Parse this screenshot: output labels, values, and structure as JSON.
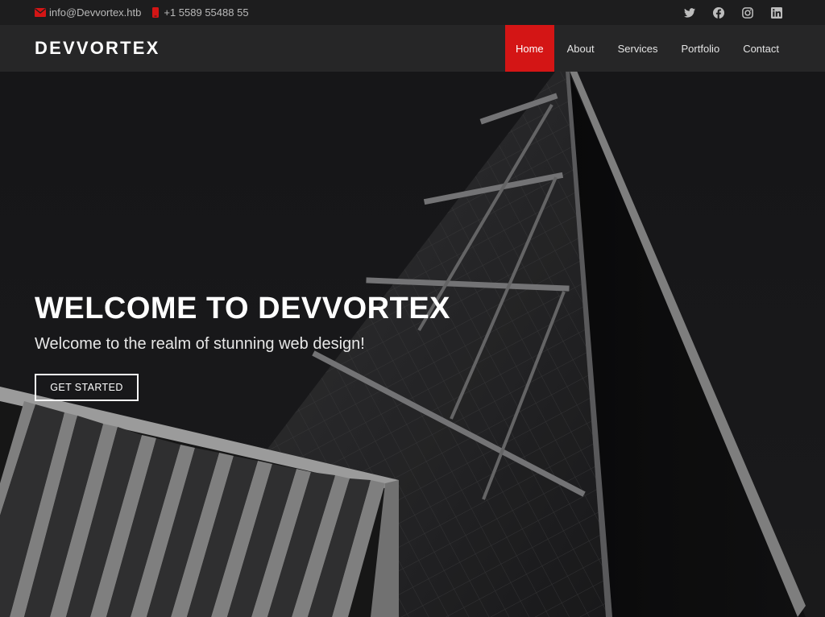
{
  "topbar": {
    "email": "info@Devvortex.htb",
    "phone": "+1 5589 55488 55",
    "email_icon": "envelope-icon",
    "phone_icon": "phone-icon",
    "social_icons": [
      "twitter-icon",
      "facebook-icon",
      "instagram-icon",
      "linkedin-icon"
    ]
  },
  "header": {
    "logo": "DEVVORTEX",
    "nav": [
      {
        "label": "Home",
        "active": true
      },
      {
        "label": "About",
        "active": false
      },
      {
        "label": "Services",
        "active": false
      },
      {
        "label": "Portfolio",
        "active": false
      },
      {
        "label": "Contact",
        "active": false
      }
    ]
  },
  "hero": {
    "title": "WELCOME TO DEVVORTEX",
    "subtitle": "Welcome to the realm of stunning web design!",
    "cta_label": "GET STARTED"
  },
  "colors": {
    "accent": "#d41515",
    "topbar_bg": "#1d1d1e",
    "header_bg": "#282829",
    "text": "#ffffff"
  }
}
